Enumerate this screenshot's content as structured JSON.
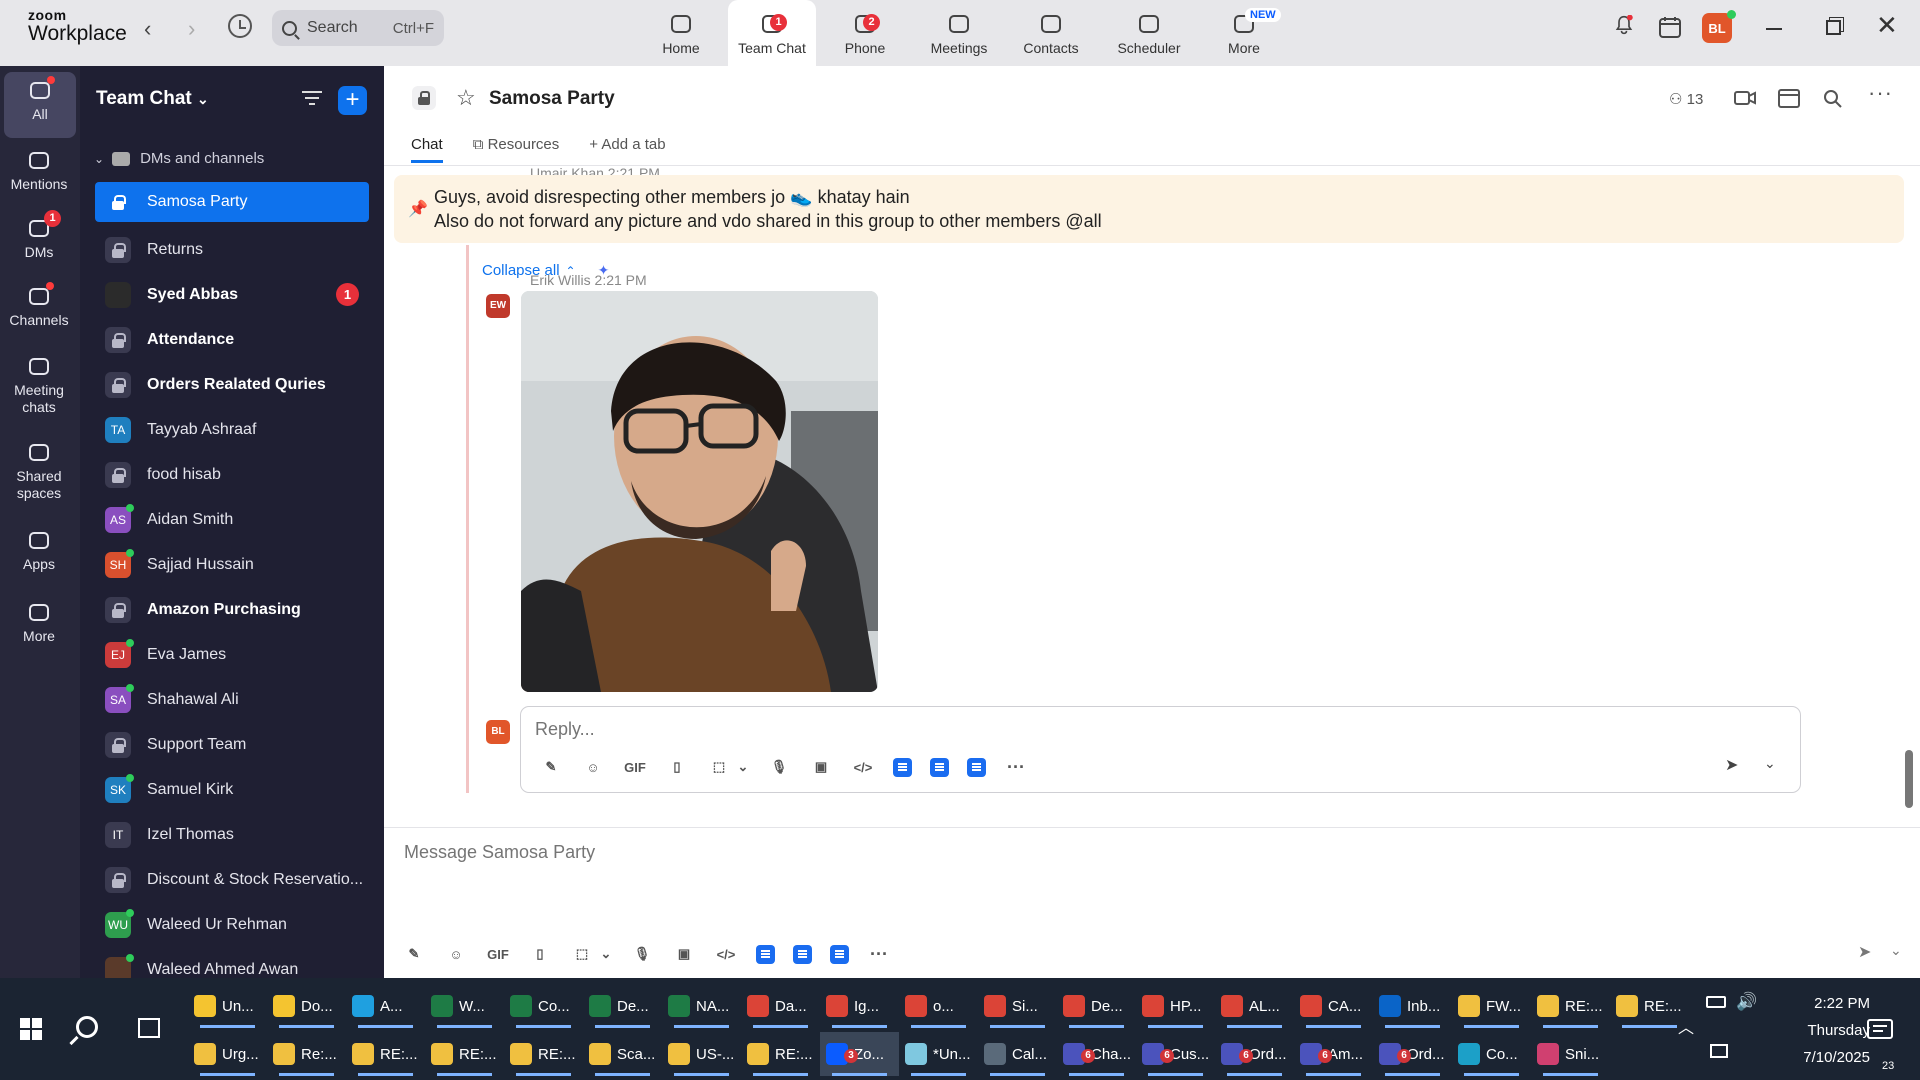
{
  "app": {
    "logo_top": "zoom",
    "logo_bottom": "Workplace"
  },
  "search": {
    "label": "Search",
    "shortcut": "Ctrl+F"
  },
  "topnav": [
    {
      "label": "Home",
      "icon": "home-icon",
      "badge": ""
    },
    {
      "label": "Team Chat",
      "icon": "chat-icon",
      "badge": "1"
    },
    {
      "label": "Phone",
      "icon": "phone-icon",
      "badge": "2"
    },
    {
      "label": "Meetings",
      "icon": "video-icon",
      "badge": ""
    },
    {
      "label": "Contacts",
      "icon": "contacts-icon",
      "badge": ""
    },
    {
      "label": "Scheduler",
      "icon": "scheduler-icon",
      "badge": ""
    },
    {
      "label": "More",
      "icon": "more-icon",
      "badge": "NEW"
    }
  ],
  "user": {
    "initials": "BL"
  },
  "rail": [
    {
      "label": "All",
      "icon": "chat-bubble-icon"
    },
    {
      "label": "Mentions",
      "icon": "at-icon"
    },
    {
      "label": "DMs",
      "icon": "people-icon",
      "badge": "1"
    },
    {
      "label": "Channels",
      "icon": "hash-icon"
    },
    {
      "label": "Meeting chats",
      "icon": "calendar-icon"
    },
    {
      "label": "Shared spaces",
      "icon": "shared-spaces-icon"
    },
    {
      "label": "Apps",
      "icon": "apps-icon"
    },
    {
      "label": "More",
      "icon": "ellipsis-icon"
    }
  ],
  "sidebar": {
    "title": "Team Chat",
    "section": "DMs and channels",
    "items": [
      {
        "label": "Samosa Party",
        "type": "lock",
        "selected": true
      },
      {
        "label": "Returns",
        "type": "lock"
      },
      {
        "label": "Syed Abbas",
        "type": "photo",
        "bold": true,
        "unread": "1",
        "color": "#2b2b2b"
      },
      {
        "label": "Attendance",
        "type": "lock",
        "bold": true
      },
      {
        "label": "Orders Realated Quries",
        "type": "lock",
        "bold": true
      },
      {
        "label": "Tayyab Ashraaf",
        "type": "initials",
        "initials": "TA",
        "color": "#1f7fbf"
      },
      {
        "label": "food hisab",
        "type": "lock"
      },
      {
        "label": "Aidan Smith",
        "type": "initials",
        "initials": "AS",
        "color": "#8a4fbf",
        "online": true
      },
      {
        "label": "Sajjad Hussain",
        "type": "initials",
        "initials": "SH",
        "color": "#d9502e",
        "online": true
      },
      {
        "label": "Amazon Purchasing",
        "type": "lock",
        "bold": true
      },
      {
        "label": "Eva James",
        "type": "initials",
        "initials": "EJ",
        "color": "#cc3b3b",
        "online": true
      },
      {
        "label": "Shahawal Ali",
        "type": "initials",
        "initials": "SA",
        "color": "#8a4fbf",
        "online": true
      },
      {
        "label": "Support Team",
        "type": "lock"
      },
      {
        "label": "Samuel Kirk",
        "type": "initials",
        "initials": "SK",
        "color": "#1f7fbf",
        "online": true
      },
      {
        "label": "Izel Thomas",
        "type": "initials",
        "initials": "IT",
        "color": "#3a3a50"
      },
      {
        "label": "Discount & Stock Reservatio...",
        "type": "lock"
      },
      {
        "label": "Waleed Ur Rehman",
        "type": "initials",
        "initials": "WU",
        "color": "#2e9e4e",
        "online": true
      },
      {
        "label": "Waleed Ahmed Awan",
        "type": "photo",
        "color": "#5a3a2a",
        "online": true
      }
    ]
  },
  "channel": {
    "name": "Samosa Party",
    "members": "13",
    "tabs": [
      "Chat",
      "Resources",
      "Add a tab"
    ]
  },
  "pinned": {
    "behind_text": "Umair Khan 2:21 PM",
    "line1": "Guys, avoid disrespecting other members jo 👟 khatay hain",
    "line2": "Also do not forward any picture and vdo shared in this group to other members @all"
  },
  "thread": {
    "collapse_label": "Collapse all",
    "message_meta": "Erik Willis 2:21 PM",
    "sender_initials": "EW",
    "reply_initials": "BL",
    "reply_placeholder": "Reply..."
  },
  "compose": {
    "placeholder": "Message Samosa Party",
    "gif_label": "GIF"
  },
  "taskbar": {
    "row1": [
      {
        "label": "Un...",
        "color": "#f4c430"
      },
      {
        "label": "Do...",
        "color": "#f4c430"
      },
      {
        "label": "A...",
        "color": "#1fa0e0"
      },
      {
        "label": "W...",
        "color": "#1e7b45"
      },
      {
        "label": "Co...",
        "color": "#1e7b45"
      },
      {
        "label": "De...",
        "color": "#1e7b45"
      },
      {
        "label": "NA...",
        "color": "#1e7b45"
      },
      {
        "label": "Da...",
        "color": "#db4437"
      },
      {
        "label": "Ig...",
        "color": "#db4437"
      },
      {
        "label": "o...",
        "color": "#db4437"
      },
      {
        "label": "Si...",
        "color": "#db4437"
      },
      {
        "label": "De...",
        "color": "#db4437"
      },
      {
        "label": "HP...",
        "color": "#db4437"
      },
      {
        "label": "AL...",
        "color": "#db4437"
      },
      {
        "label": "CA...",
        "color": "#db4437"
      },
      {
        "label": "Inb...",
        "color": "#0a64c8"
      },
      {
        "label": "FW...",
        "color": "#f0c040"
      },
      {
        "label": "RE:...",
        "color": "#f0c040"
      },
      {
        "label": "RE:...",
        "color": "#f0c040"
      }
    ],
    "row2": [
      {
        "label": "Urg...",
        "color": "#f0c040"
      },
      {
        "label": "Re:...",
        "color": "#f0c040"
      },
      {
        "label": "RE:...",
        "color": "#f0c040"
      },
      {
        "label": "RE:...",
        "color": "#f0c040"
      },
      {
        "label": "RE:...",
        "color": "#f0c040"
      },
      {
        "label": "Sca...",
        "color": "#f0c040"
      },
      {
        "label": "US-...",
        "color": "#f0c040"
      },
      {
        "label": "RE:...",
        "color": "#f0c040"
      },
      {
        "label": "Zo...",
        "color": "#0b5cff",
        "num": "3",
        "focus": true
      },
      {
        "label": "*Un...",
        "color": "#7fc8e0"
      },
      {
        "label": "Cal...",
        "color": "#5a6a7a"
      },
      {
        "label": "Cha...",
        "color": "#4b53bc",
        "num": "6"
      },
      {
        "label": "Cus...",
        "color": "#4b53bc",
        "num": "6"
      },
      {
        "label": "Ord...",
        "color": "#4b53bc",
        "num": "6"
      },
      {
        "label": "Am...",
        "color": "#4b53bc",
        "num": "6"
      },
      {
        "label": "Ord...",
        "color": "#4b53bc",
        "num": "6"
      },
      {
        "label": "Co...",
        "color": "#1ca0c8"
      },
      {
        "label": "Sni...",
        "color": "#d04070"
      }
    ],
    "time": "2:22 PM",
    "day": "Thursday",
    "date": "7/10/2025",
    "notifications": "23"
  }
}
